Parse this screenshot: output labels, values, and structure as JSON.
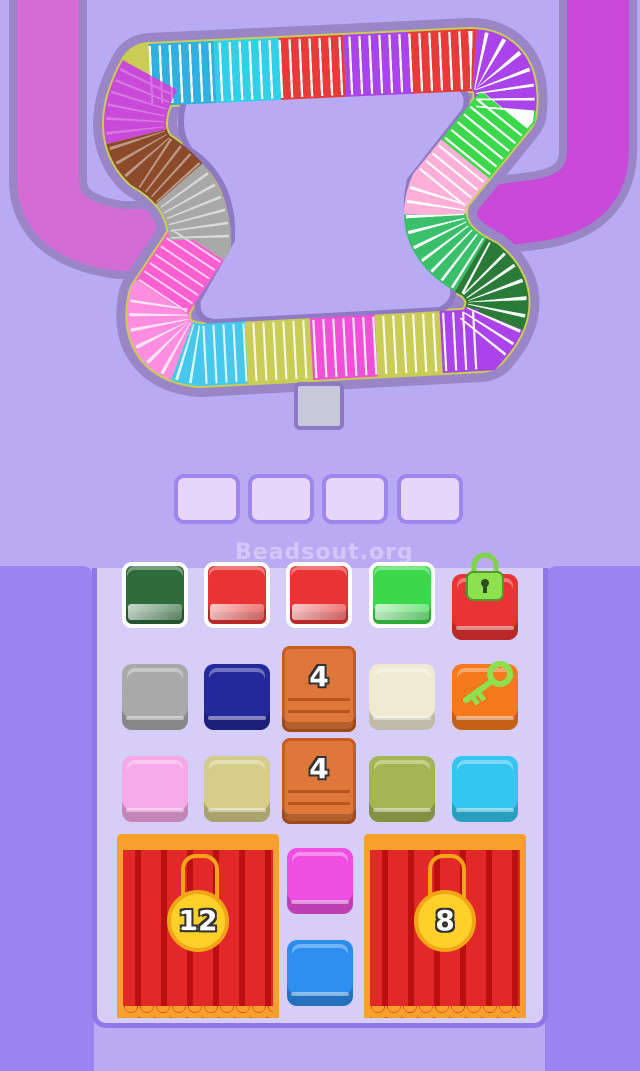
{
  "watermark": "Beadsout.org",
  "colors": {
    "background": "#b8abf4",
    "board": "#d6cdf9",
    "panel": "#9a85f0",
    "slot": "#e8d6fa"
  },
  "conveyor": {
    "segments": [
      {
        "color": "#2fb0e0"
      },
      {
        "color": "#2fd0e8"
      },
      {
        "color": "#e93a3a"
      },
      {
        "color": "#aa44ea"
      },
      {
        "color": "#e93a3a"
      },
      {
        "color": "#aa44ea"
      },
      {
        "color": "#3ad84a"
      },
      {
        "color": "#ffb0d8"
      },
      {
        "color": "#3ac06a"
      },
      {
        "color": "#2a7a38"
      },
      {
        "color": "#aa44ea"
      },
      {
        "color": "#c9cc55"
      },
      {
        "color": "#f050d8"
      },
      {
        "color": "#c9cc55"
      },
      {
        "color": "#45c8ec"
      },
      {
        "color": "#ff8ee0"
      },
      {
        "color": "#ff5fd0"
      },
      {
        "color": "#a8a8a8"
      },
      {
        "color": "#8b4a2a"
      },
      {
        "color": "#c94ad8"
      }
    ]
  },
  "collection_slots": [
    {
      "state": "empty"
    },
    {
      "state": "empty"
    },
    {
      "state": "empty"
    },
    {
      "state": "empty"
    }
  ],
  "boxes": [
    {
      "name": "box-dark-green",
      "color": "#2e6b3a",
      "selected": true
    },
    {
      "name": "box-red-1",
      "color": "#e83434",
      "selected": true
    },
    {
      "name": "box-red-2",
      "color": "#e83434",
      "selected": true
    },
    {
      "name": "box-green",
      "color": "#3ad84a",
      "selected": true
    },
    {
      "name": "box-red-locked",
      "color": "#e83434",
      "selected": false,
      "locked": true,
      "lock_icon": "padlock-icon"
    },
    {
      "name": "box-gray",
      "color": "#a9a9a9",
      "selected": false
    },
    {
      "name": "box-navy",
      "color": "#23289a",
      "selected": false
    },
    {
      "name": "box-cream",
      "color": "#f0ead2",
      "selected": false
    },
    {
      "name": "box-orange-key",
      "color": "#f67a1c",
      "selected": false,
      "key_icon": "key-icon"
    },
    {
      "name": "box-pink",
      "color": "#f6a8e8",
      "selected": false
    },
    {
      "name": "box-tan",
      "color": "#d6cc8a",
      "selected": false
    },
    {
      "name": "box-olive",
      "color": "#a6b553",
      "selected": false
    },
    {
      "name": "box-cyan",
      "color": "#33c6f0",
      "selected": false
    },
    {
      "name": "box-magenta",
      "color": "#f04ee0",
      "selected": false
    },
    {
      "name": "box-blue",
      "color": "#2d8ef0",
      "selected": false
    }
  ],
  "crates": [
    {
      "count": "4"
    },
    {
      "count": "4"
    }
  ],
  "curtains": [
    {
      "count": "12"
    },
    {
      "count": "8"
    }
  ]
}
